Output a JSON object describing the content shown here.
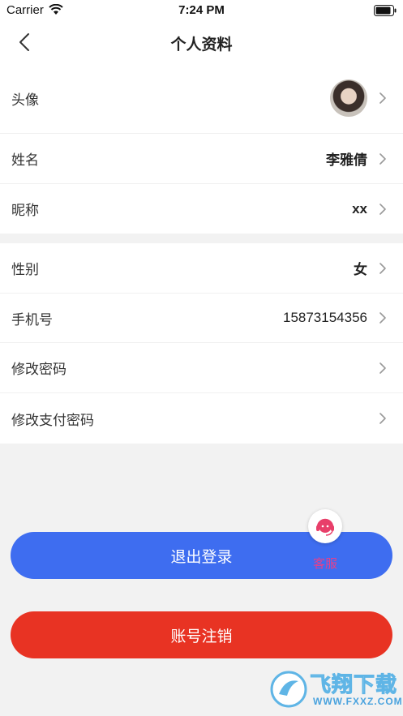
{
  "status_bar": {
    "carrier": "Carrier",
    "time": "7:24 PM"
  },
  "nav": {
    "title": "个人资料"
  },
  "profile_rows": [
    {
      "label": "头像",
      "value": ""
    },
    {
      "label": "姓名",
      "value": "李雅倩"
    },
    {
      "label": "昵称",
      "value": "xx"
    }
  ],
  "account_rows": [
    {
      "label": "性别",
      "value": "女"
    },
    {
      "label": "手机号",
      "value": "15873154356"
    },
    {
      "label": "修改密码",
      "value": ""
    },
    {
      "label": "修改支付密码",
      "value": ""
    }
  ],
  "buttons": {
    "logout": "退出登录",
    "cancel_account": "账号注销"
  },
  "service": {
    "label": "客服"
  },
  "watermark": {
    "text": "飞翔下载",
    "sub": "WWW.FXXZ.COM"
  },
  "colors": {
    "logout": "#3e6df0",
    "cancel": "#e83323",
    "service": "#e83f8a"
  }
}
